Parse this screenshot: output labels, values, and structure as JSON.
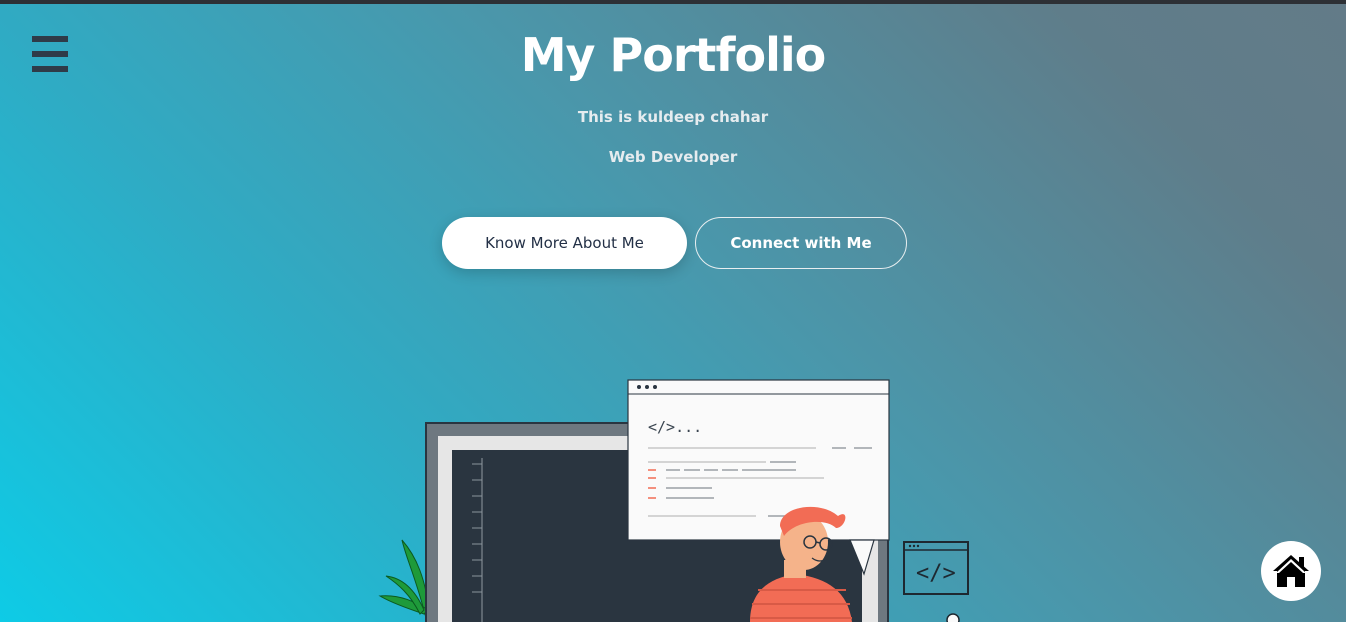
{
  "header": {
    "title": "My Portfolio",
    "subtitle": "This is kuldeep chahar",
    "role": "Web Developer"
  },
  "nav": {
    "menu_icon": "hamburger-menu-icon"
  },
  "actions": {
    "primary_label": "Know More About Me",
    "secondary_label": "Connect with Me"
  },
  "illustration": {
    "code_text": "</>...",
    "code_icon_text": "</>"
  },
  "floating": {
    "home_icon": "home-icon"
  },
  "colors": {
    "gradient_start": "#0ecbe6",
    "gradient_end": "#637b88",
    "accent": "#f26c55",
    "monitor": "#2a3540"
  }
}
